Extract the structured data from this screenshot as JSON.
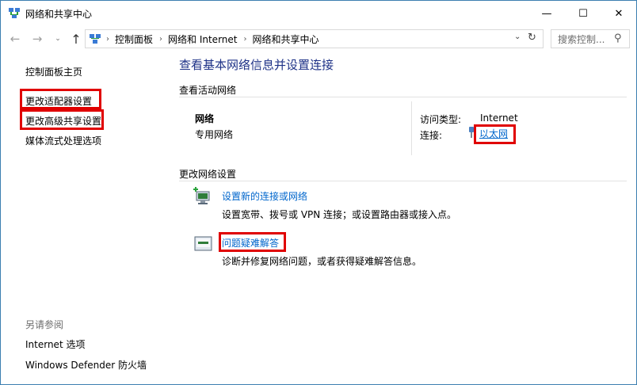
{
  "window": {
    "title": "网络和共享中心",
    "minimize_glyph": "—",
    "maximize_glyph": "☐",
    "close_glyph": "✕"
  },
  "addressbar": {
    "back_glyph": "←",
    "forward_glyph": "→",
    "recent_glyph": "⌄",
    "up_glyph": "↑",
    "breadcrumbs": [
      "控制面板",
      "网络和 Internet",
      "网络和共享中心"
    ],
    "separator": "›",
    "dropdown_glyph": "⌄",
    "refresh_glyph": "↻",
    "search_placeholder": "搜索控制...",
    "search_glyph": "⚲"
  },
  "sidebar": {
    "home": "控制面板主页",
    "items": [
      "更改适配器设置",
      "更改高级共享设置",
      "媒体流式处理选项"
    ],
    "see_also_title": "另请参阅",
    "see_also": [
      "Internet 选项",
      "Windows Defender 防火墙"
    ]
  },
  "main": {
    "heading": "查看基本网络信息并设置连接",
    "active_section": "查看活动网络",
    "network": {
      "name": "网络",
      "type": "专用网络",
      "access_label": "访问类型:",
      "access_value": "Internet",
      "connection_label": "连接:",
      "connection_value": "以太网"
    },
    "change_section": "更改网络设置",
    "tasks": [
      {
        "title": "设置新的连接或网络",
        "desc": "设置宽带、拨号或 VPN 连接；或设置路由器或接入点。"
      },
      {
        "title": "问题疑难解答",
        "desc": "诊断并修复网络问题，或者获得疑难解答信息。"
      }
    ]
  },
  "colors": {
    "highlight_box": "#e00000",
    "link": "#0066cc",
    "heading": "#1e3287",
    "window_border": "#3c7fb1"
  },
  "icons": {
    "app": "network-icon",
    "connection": "ethernet-icon",
    "task_new_connection": "network-setup-icon",
    "task_troubleshoot": "troubleshoot-icon"
  }
}
